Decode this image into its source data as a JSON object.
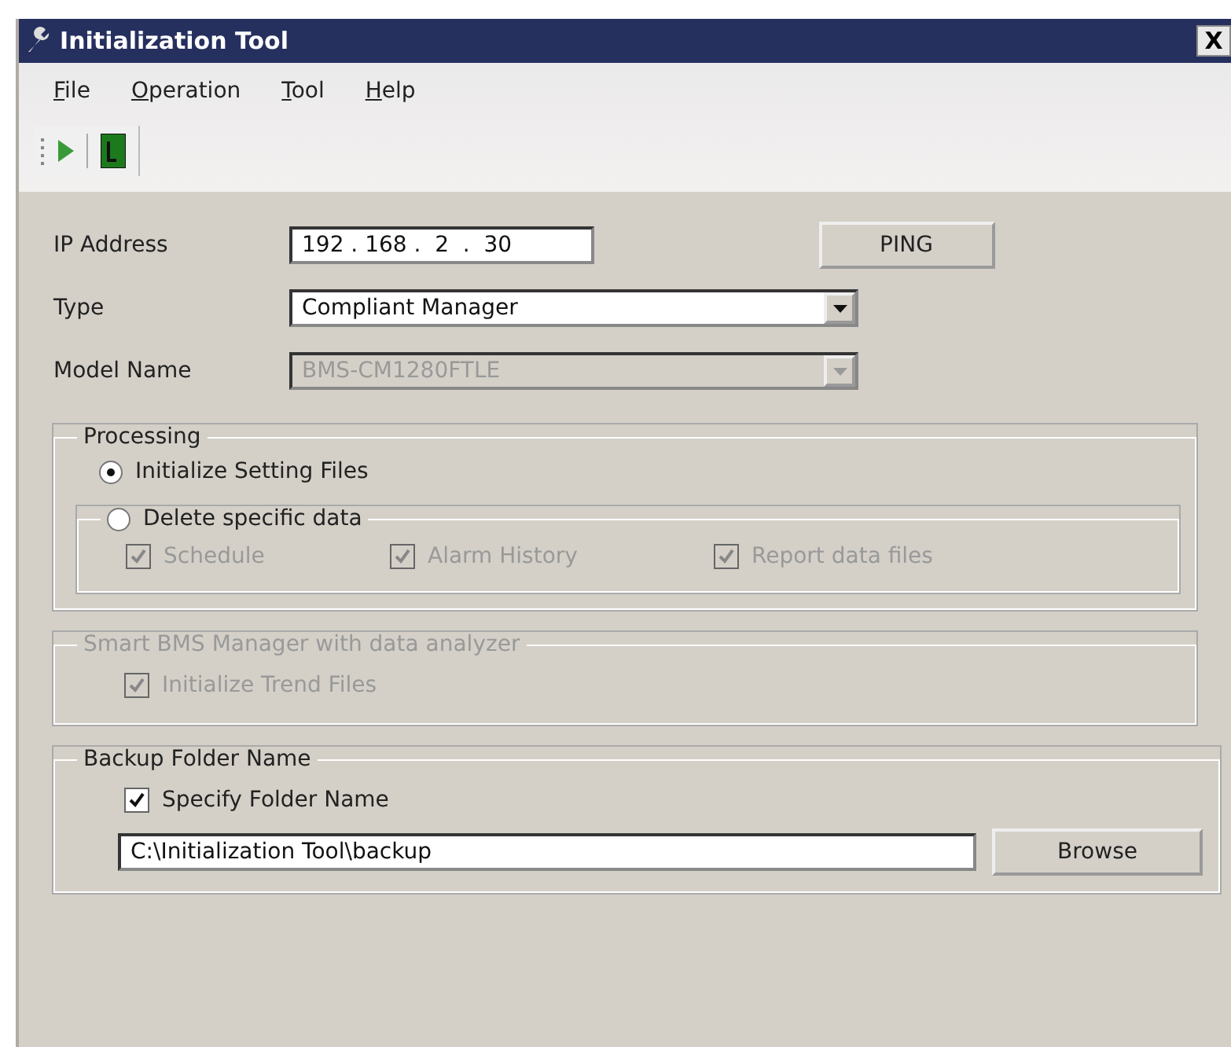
{
  "window": {
    "title": "Initialization Tool",
    "close": "X"
  },
  "menu": [
    {
      "label": "File"
    },
    {
      "label": "Operation"
    },
    {
      "label": "Tool"
    },
    {
      "label": "Help"
    }
  ],
  "ip": {
    "label": "IP Address",
    "value": "192 . 168 .  2  .  30",
    "button": "PING"
  },
  "type": {
    "label": "Type",
    "value": "Compliant Manager",
    "disabled": false
  },
  "model": {
    "label": "Model Name",
    "value": "BMS-CM1280FTLE",
    "disabled": true
  },
  "processing": {
    "title": "Processing",
    "options": [
      {
        "label": "Initialize Setting Files",
        "selected": true
      },
      {
        "label": "Delete specific data",
        "selected": false
      }
    ],
    "items": [
      {
        "label": "Schedule",
        "checked": true,
        "disabled": true
      },
      {
        "label": "Alarm History",
        "checked": true,
        "disabled": true
      },
      {
        "label": "Report data files",
        "checked": true,
        "disabled": true
      }
    ]
  },
  "smart": {
    "title": "Smart BMS Manager with data analyzer",
    "disabled": true,
    "item": {
      "label": "Initialize Trend Files",
      "checked": true,
      "disabled": true
    }
  },
  "backup": {
    "title": "Backup Folder Name",
    "item": {
      "label": "Specify Folder Name",
      "checked": true,
      "disabled": false
    },
    "value": "C:\\Initialization Tool\\backup",
    "button": "Browse"
  }
}
